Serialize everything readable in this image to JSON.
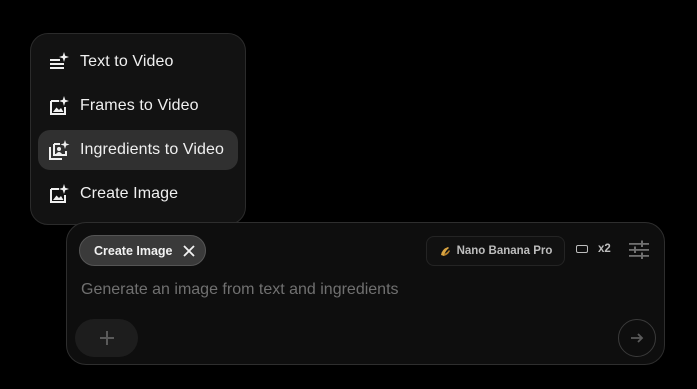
{
  "menu": {
    "items": [
      {
        "label": "Text to Video",
        "icon": "text-sparkle-icon",
        "active": false
      },
      {
        "label": "Frames to Video",
        "icon": "image-sparkle-icon",
        "active": false
      },
      {
        "label": "Ingredients to Video",
        "icon": "layers-sparkle-icon",
        "active": true
      },
      {
        "label": "Create Image",
        "icon": "image-add-sparkle-icon",
        "active": false
      }
    ]
  },
  "composer": {
    "mode_chip": {
      "label": "Create Image"
    },
    "model": {
      "label": "Nano Banana Pro",
      "icon": "banana-icon"
    },
    "aspect": {
      "label": "x2",
      "icon": "aspect-ratio-icon"
    },
    "settings_icon": "sliders-icon",
    "prompt": {
      "value": "",
      "placeholder": "Generate an image from text and ingredients"
    },
    "add_icon": "plus-icon",
    "send_icon": "arrow-right-icon"
  },
  "colors": {
    "background": "#000000",
    "menu_bg": "#121212",
    "active_item": "#303030",
    "chip_bg": "#3a3a3a",
    "placeholder": "#707070"
  }
}
